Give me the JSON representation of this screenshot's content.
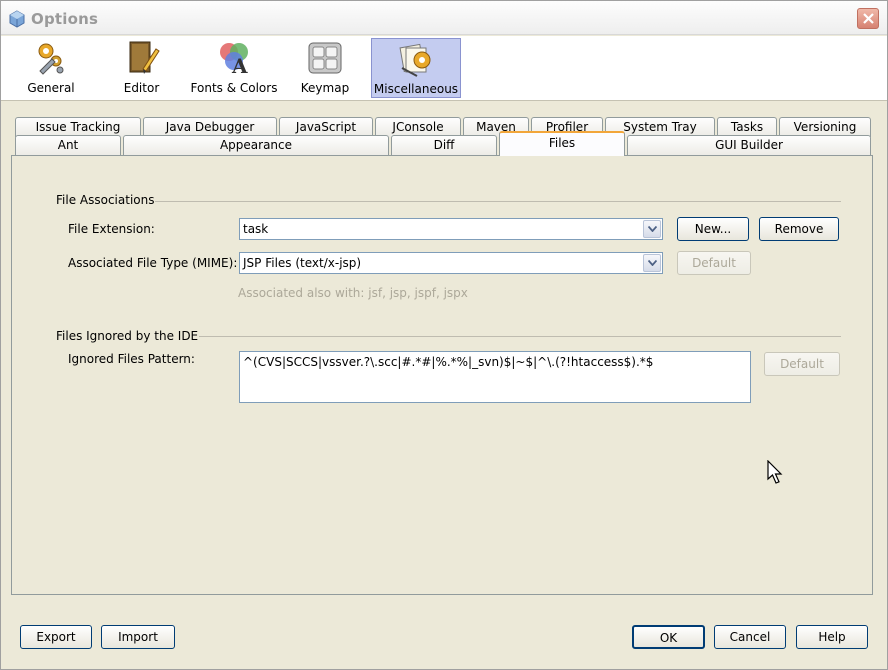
{
  "window": {
    "title": "Options"
  },
  "categories": [
    {
      "label": "General",
      "icon": "gears-wrench-icon"
    },
    {
      "label": "Editor",
      "icon": "book-pencil-icon"
    },
    {
      "label": "Fonts & Colors",
      "icon": "fonts-colors-icon"
    },
    {
      "label": "Keymap",
      "icon": "keyboard-icon"
    },
    {
      "label": "Miscellaneous",
      "icon": "miscellaneous-icon",
      "selected": true
    }
  ],
  "tabs_row1": [
    "Issue Tracking",
    "Java Debugger",
    "JavaScript",
    "JConsole",
    "Maven",
    "Profiler",
    "System Tray",
    "Tasks",
    "Versioning"
  ],
  "tabs_row2": [
    "Ant",
    "Appearance",
    "Diff",
    "Files",
    "GUI Builder"
  ],
  "active_tab": "Files",
  "file_associations": {
    "title": "File Associations",
    "extension_label": "File Extension:",
    "extension_value": "task",
    "new_button": "New...",
    "remove_button": "Remove",
    "mime_label": "Associated File Type (MIME):",
    "mime_value": "JSP Files (text/x-jsp)",
    "default_button": "Default",
    "also_with": "Associated also with:  jsf, jsp, jspf, jspx"
  },
  "ignored": {
    "title": "Files Ignored by the IDE",
    "pattern_label": "Ignored Files Pattern:",
    "pattern_value": "^(CVS|SCCS|vssver.?\\.scc|#.*#|%.*%|_svn)$|~$|^\\.(?!htaccess$).*$",
    "default_button": "Default"
  },
  "footer": {
    "export": "Export",
    "import": "Import",
    "ok": "OK",
    "cancel": "Cancel",
    "help": "Help"
  },
  "colors": {
    "selected_category_bg": "#c4ccf0",
    "active_tab_accent": "#f2a63a",
    "close_button": "#d68272"
  }
}
